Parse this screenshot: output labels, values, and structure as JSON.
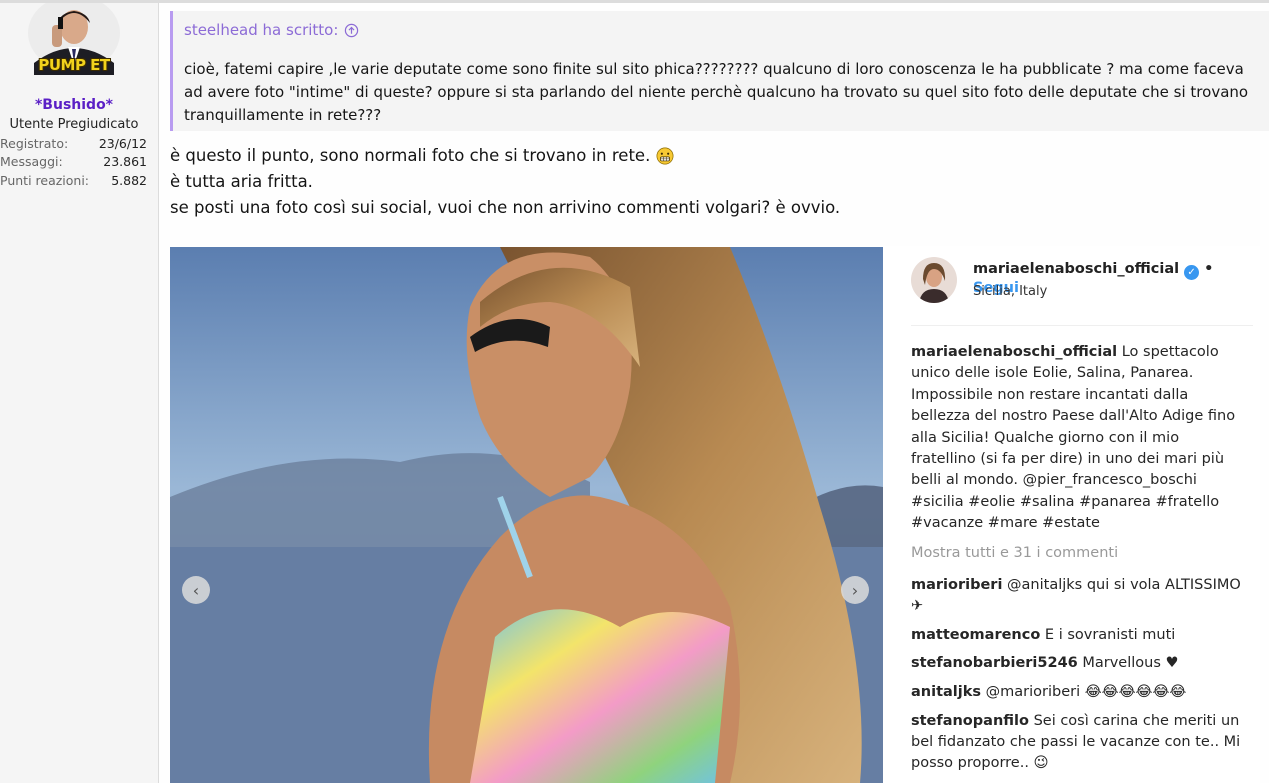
{
  "user": {
    "avatar_caption": "PUMP ET",
    "name": "*Bushido*",
    "title": "Utente Pregiudicato",
    "stats": [
      {
        "label": "Registrato:",
        "value": "23/6/12"
      },
      {
        "label": "Messaggi:",
        "value": "23.861"
      },
      {
        "label": "Punti reazioni:",
        "value": "5.882"
      }
    ]
  },
  "quote": {
    "header": "steelhead ha scritto:",
    "text": "cioè, fatemi capire ,le varie deputate come sono finite sul sito phica???????? qualcuno di loro conoscenza le ha pubblicate ? ma come faceva ad avere foto \"intime\" di queste? oppure si sta parlando del niente perchè qualcuno ha trovato su quel sito foto delle deputate che si trovano tranquillamente in rete???"
  },
  "post": {
    "lines": [
      "è questo il punto, sono normali foto che si trovano in rete.",
      "è tutta aria fritta.",
      "se posti una foto così sui social, vuoi che non arrivino commenti volgari? è ovvio."
    ]
  },
  "instagram": {
    "username": "mariaelenaboschi_official",
    "follow": "Segui",
    "location": "Sicilia, Italy",
    "caption_user": "mariaelenaboschi_official",
    "caption": "Lo spettacolo unico delle isole Eolie, Salina, Panarea. Impossibile non restare incantati dalla bellezza del nostro Paese dall'Alto Adige fino alla Sicilia! Qualche giorno con il mio fratellino (si fa per dire) in uno dei mari più belli al mondo. @pier_francesco_boschi #sicilia #eolie #salina #panarea #fratello #vacanze #mare #estate",
    "more_comments": "Mostra tutti e 31 i commenti",
    "comments": [
      {
        "user": "marioriberi",
        "text": "@anitaljks qui si vola ALTISSIMO✈"
      },
      {
        "user": "matteomarenco",
        "text": "E i sovranisti muti"
      },
      {
        "user": "stefanobarbieri5246",
        "text": "Marvellous ♥"
      },
      {
        "user": "anitaljks",
        "text": "@marioriberi 😂😂😂😂😂😂"
      },
      {
        "user": "stefanopanfilo",
        "text": "Sei così carina che meriti un bel fidanzato che passi le vacanze con te.. Mi posso proporre.. 😉"
      }
    ]
  },
  "colors": {
    "accent_purple": "#5a1fc6",
    "quote_border": "#b89bf0",
    "ig_blue": "#3897f0"
  }
}
